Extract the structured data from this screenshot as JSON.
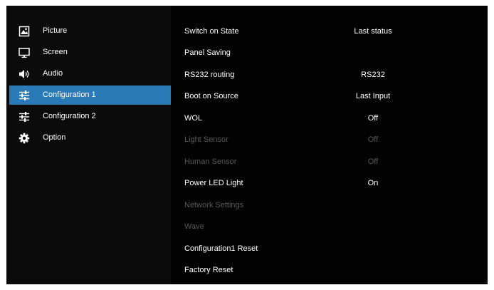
{
  "sidebar": {
    "items": [
      {
        "label": "Picture",
        "icon": "picture-icon"
      },
      {
        "label": "Screen",
        "icon": "monitor-icon"
      },
      {
        "label": "Audio",
        "icon": "speaker-icon"
      },
      {
        "label": "Configuration 1",
        "icon": "sliders-icon",
        "selected": true
      },
      {
        "label": "Configuration 2",
        "icon": "sliders-icon"
      },
      {
        "label": "Option",
        "icon": "gear-icon"
      }
    ]
  },
  "settings": {
    "rows": [
      {
        "label": "Switch on State",
        "value": "Last status"
      },
      {
        "label": "Panel Saving",
        "value": ""
      },
      {
        "label": "RS232 routing",
        "value": "RS232"
      },
      {
        "label": "Boot on Source",
        "value": "Last Input"
      },
      {
        "label": "WOL",
        "value": "Off"
      },
      {
        "label": "Light Sensor",
        "value": "Off",
        "disabled": true
      },
      {
        "label": "Human Sensor",
        "value": "Off",
        "disabled": true
      },
      {
        "label": "Power LED Light",
        "value": "On"
      },
      {
        "label": "Network Settings",
        "value": "",
        "disabled": true
      },
      {
        "label": "Wave",
        "value": "",
        "disabled": true
      },
      {
        "label": "Configuration1 Reset",
        "value": ""
      },
      {
        "label": "Factory Reset",
        "value": ""
      }
    ]
  },
  "colors": {
    "selection": "#2a7ab8",
    "text": "#ffffff",
    "disabled_text": "#5a5a5a",
    "background": "#000000"
  }
}
